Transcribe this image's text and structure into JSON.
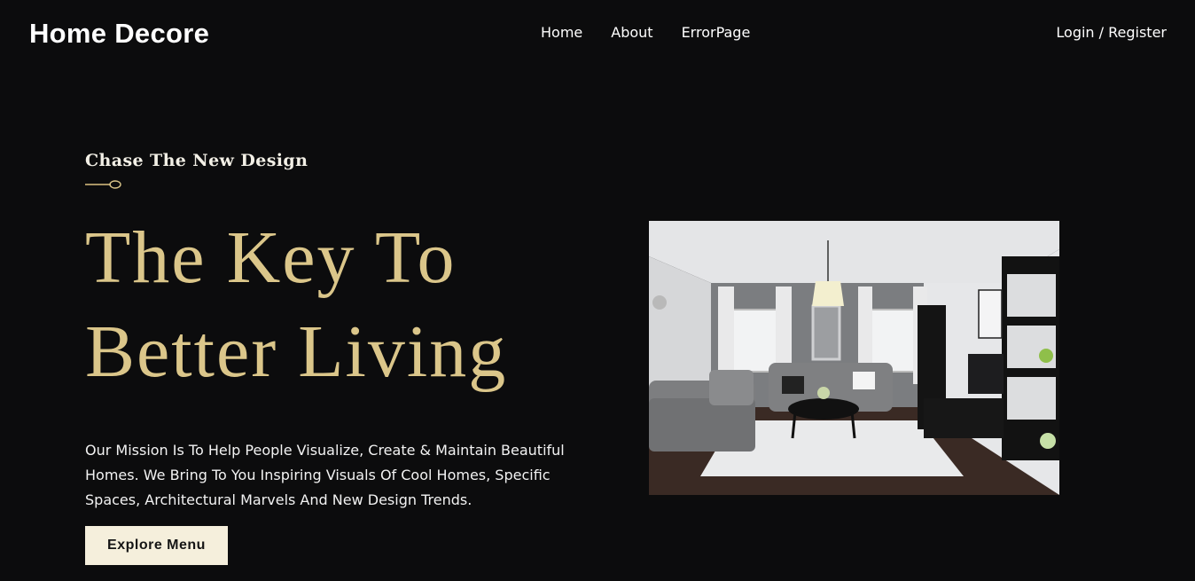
{
  "header": {
    "brand": "Home Decore",
    "nav": [
      "Home",
      "About",
      "ErrorPage"
    ],
    "auth_link": "Login / Register"
  },
  "hero": {
    "eyebrow": "Chase The New Design",
    "headline_line1": "The Key To",
    "headline_line2": "Better Living",
    "mission": "Our Mission Is To Help People Visualize, Create & Maintain Beautiful Homes. We Bring To You Inspiring Visuals Of Cool Homes, Specific Spaces, Architectural Marvels And New Design Trends.",
    "cta_label": "Explore Menu",
    "image_icon": "living-room-photo"
  },
  "colors": {
    "background": "#0c0c0d",
    "accent_gold": "#dbc68a",
    "button_bg": "#f5efdc"
  }
}
